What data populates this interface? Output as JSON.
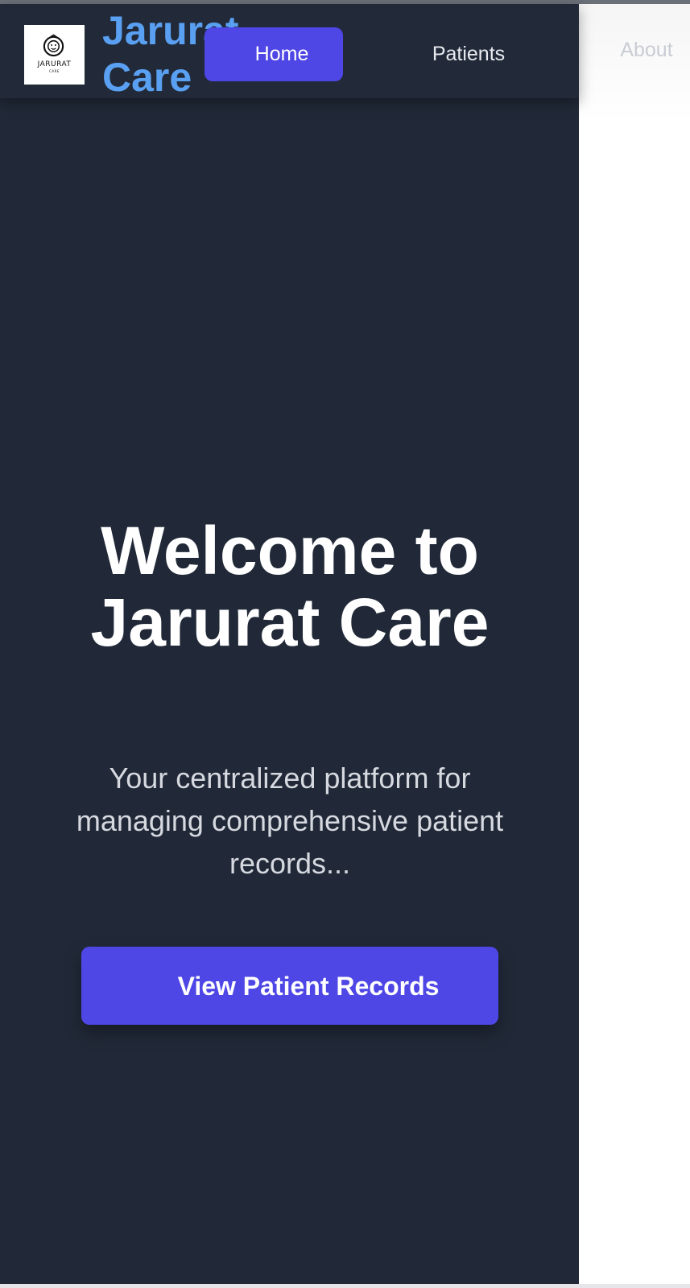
{
  "logo": {
    "name": "jarurat-care-logo-icon",
    "word": "JARURAT",
    "sub": "CARE"
  },
  "header": {
    "brand": "Jarurat\nCare"
  },
  "nav": {
    "home": "Home",
    "patients": "Patients",
    "about": "About"
  },
  "hero": {
    "title": "Welcome to Jarurat Care",
    "subtitle": "Your centralized platform for managing comprehensive patient records...",
    "cta": "View Patient Records"
  },
  "colors": {
    "page_bg": "#212938",
    "brand_text": "#5aa0f2",
    "accent": "#4e46e5",
    "text_primary": "#ffffff",
    "text_secondary": "#d6d9df"
  }
}
